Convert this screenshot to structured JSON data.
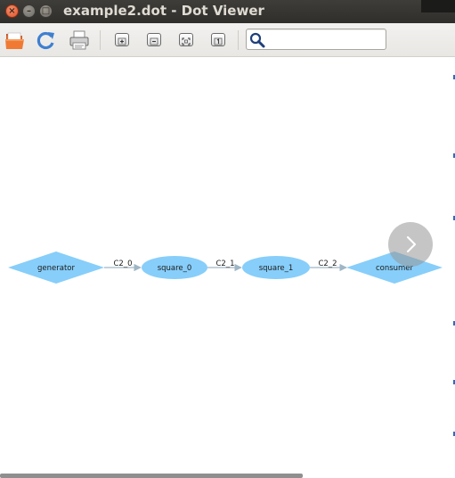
{
  "window": {
    "title": "example2.dot - Dot Viewer",
    "controls": {
      "close": "×",
      "minimize": "–",
      "maximize": "□"
    }
  },
  "toolbar": {
    "open_icon": "folder-open-icon",
    "reload_icon": "refresh-icon",
    "print_icon": "printer-icon",
    "zoom_in_icon": "zoom-in-icon",
    "zoom_out_icon": "zoom-out-icon",
    "zoom_fit_icon": "zoom-fit-icon",
    "zoom_100_icon": "zoom-100-icon",
    "search": {
      "value": "",
      "placeholder": "",
      "icon": "search-icon"
    }
  },
  "graph": {
    "node_color": "#87cefa",
    "edge_color": "#9fb6c6",
    "nodes": [
      {
        "id": "generator",
        "label": "generator",
        "shape": "diamond"
      },
      {
        "id": "square_0",
        "label": "square_0",
        "shape": "ellipse"
      },
      {
        "id": "square_1",
        "label": "square_1",
        "shape": "ellipse"
      },
      {
        "id": "consumer",
        "label": "consumer",
        "shape": "diamond"
      }
    ],
    "edges": [
      {
        "from": "generator",
        "to": "square_0",
        "label": "C2_0"
      },
      {
        "from": "square_0",
        "to": "square_1",
        "label": "C2_1"
      },
      {
        "from": "square_1",
        "to": "consumer",
        "label": "C2_2"
      }
    ]
  },
  "overlay": {
    "next_icon": "chevron-right-icon"
  }
}
